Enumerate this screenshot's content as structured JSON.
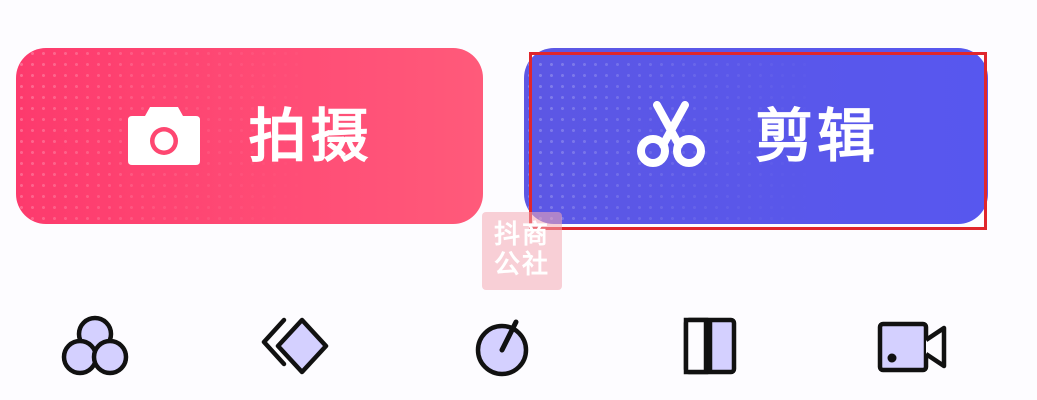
{
  "buttons": {
    "shoot": {
      "label": "拍摄",
      "icon": "camera-icon",
      "color_start": "#fd3a6d",
      "color_end": "#ff5a7a"
    },
    "edit": {
      "label": "剪辑",
      "icon": "scissors-icon",
      "color": "#5757ef",
      "highlighted": true
    }
  },
  "watermark": {
    "line1": "抖商",
    "line2": "公社"
  },
  "tools": [
    {
      "icon": "filter-circles-icon"
    },
    {
      "icon": "layers-icon"
    },
    {
      "icon": "speed-dial-icon"
    },
    {
      "icon": "split-panel-icon"
    },
    {
      "icon": "video-camera-icon"
    }
  ],
  "colors": {
    "icon_fill": "#d4d0ff",
    "icon_stroke": "#111111",
    "highlight_border": "#e0262c"
  }
}
